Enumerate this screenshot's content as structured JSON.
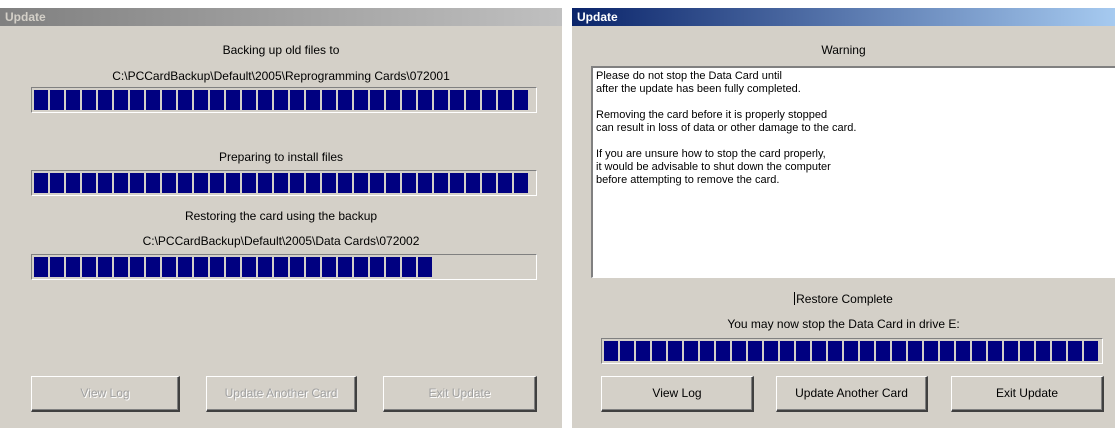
{
  "left_dialog": {
    "title": "Update",
    "backup_heading": "Backing up old files to",
    "backup_path": "C:\\PCCardBackup\\Default\\2005\\Reprogramming Cards\\072001",
    "backup_progress": 1.0,
    "prepare_heading": "Preparing to install files",
    "prepare_progress": 1.0,
    "restore_heading": "Restoring the card using the backup",
    "restore_path": "C:\\PCCardBackup\\Default\\2005\\Data Cards\\072002",
    "restore_progress": 0.785,
    "buttons": {
      "view_log": "View Log",
      "update_another": "Update Another Card",
      "exit_update": "Exit Update"
    }
  },
  "right_dialog": {
    "title": "Update",
    "warning_heading": "Warning",
    "warning_lines": {
      "l1": "Please do not stop the Data Card until",
      "l2": "after the update has been fully completed.",
      "l3": "Removing the card before it is properly stopped",
      "l4": "can result in loss of data or other damage to the card.",
      "l5": "If you are unsure how to stop the card properly,",
      "l6": "it would be advisable to shut down the computer",
      "l7": "before attempting to remove the card."
    },
    "status_title": "Restore Complete",
    "status_message": "You may now stop the Data Card in drive E:",
    "progress": 1.0,
    "buttons": {
      "view_log": "View Log",
      "update_another": "Update Another Card",
      "exit_update": "Exit Update"
    }
  },
  "colors": {
    "progress_fill": "#000080",
    "dialog_face": "#d4d0c8",
    "active_title": "#0a246a",
    "inactive_title": "#808080"
  }
}
